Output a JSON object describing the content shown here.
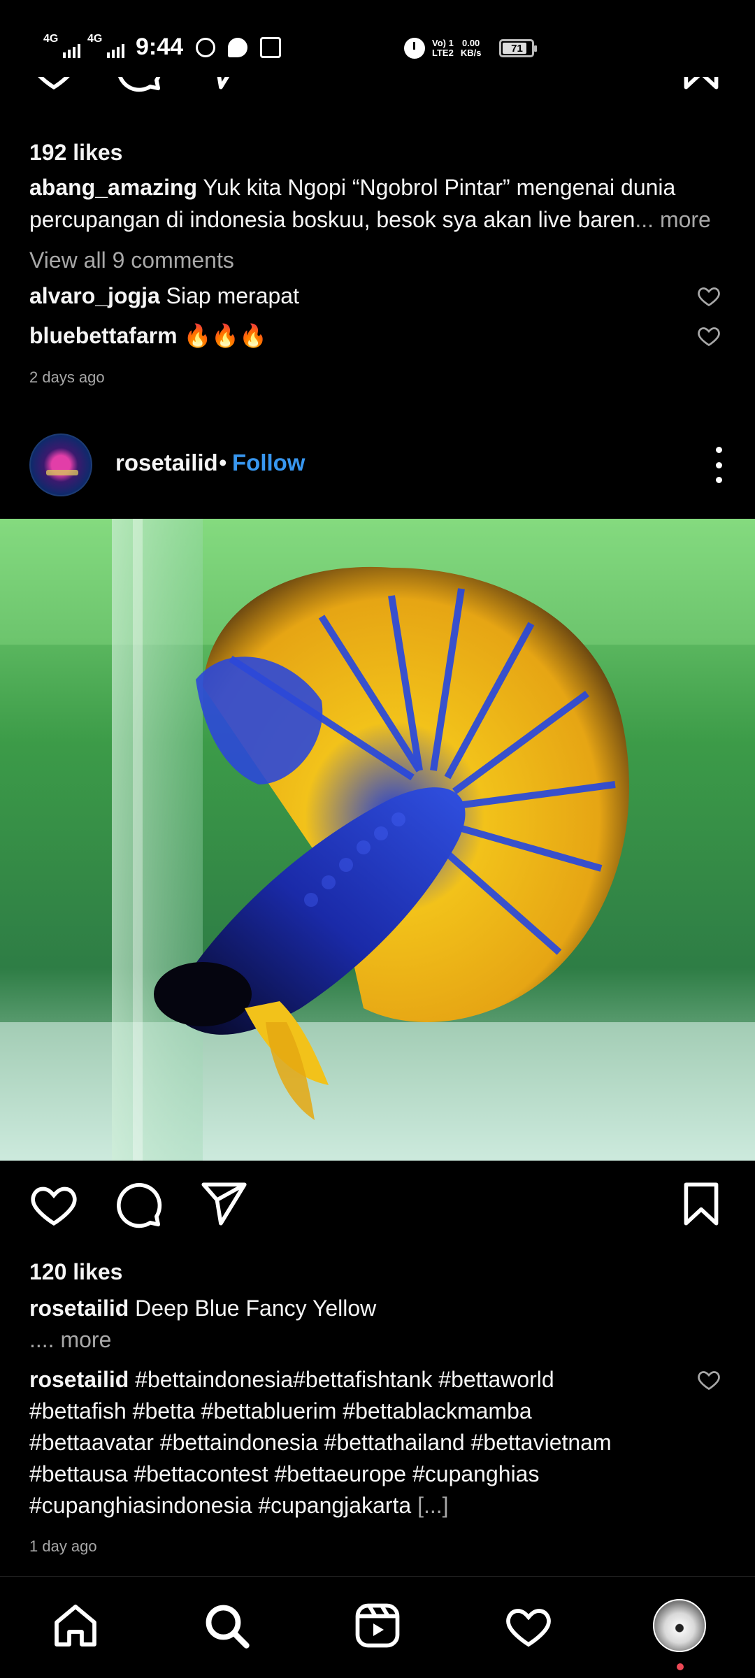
{
  "status_bar": {
    "network_1": "4G",
    "network_2": "4G",
    "time": "9:44",
    "volte": "Vo) 1",
    "lte": "LTE2",
    "speed_value": "0.00",
    "speed_unit": "KB/s",
    "battery": "71",
    "icons": [
      "whatsapp-icon",
      "message-icon",
      "calendar-icon",
      "alarm-icon"
    ]
  },
  "post1": {
    "likes": "192 likes",
    "caption_user": "abang_amazing",
    "caption_line1": "Yuk kita Ngopi “Ngobrol Pintar” mengenai dunia",
    "caption_line2": "percupangan di indonesia boskuu, besok sya akan live baren",
    "caption_more": "... more",
    "view_comments": "View all 9 comments",
    "comments": [
      {
        "user": "alvaro_jogja",
        "text": "Siap merapat"
      },
      {
        "user": "bluebettafarm",
        "text": "🔥🔥🔥"
      }
    ],
    "time_ago": "2 days ago"
  },
  "post2": {
    "username": "rosetailid",
    "separator": "•",
    "follow_label": "Follow",
    "likes": "120 likes",
    "caption_user": "rosetailid",
    "caption_text": "Deep Blue Fancy Yellow",
    "caption_more": ".... more",
    "comment": {
      "user": "rosetailid",
      "line1": "#bettaindonesia#bettafishtank #bettaworld",
      "line2": "#bettafish #betta #bettabluerim #bettablackmamba",
      "line3": "#bettaavatar #bettaindonesia #bettathailand #bettavietnam",
      "line4": "#bettausa #bettacontest #bettaeurope #cupanghias",
      "line5": "#cupanghiasindonesia #cupangjakarta",
      "truncation": "[...]"
    },
    "time_ago": "1 day ago"
  },
  "bottom_nav": {
    "items": [
      "home-icon",
      "search-icon",
      "reels-icon",
      "activity-heart-icon",
      "profile-avatar"
    ]
  },
  "colors": {
    "background": "#000000",
    "text": "#f5f5f5",
    "muted": "#a8a8a8",
    "link": "#3897f0",
    "notification": "#ed4956"
  }
}
